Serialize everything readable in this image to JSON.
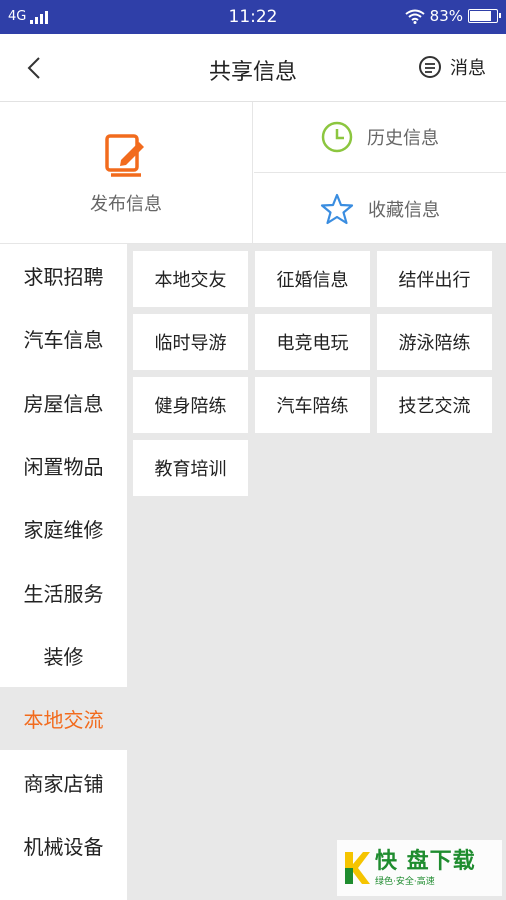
{
  "status_bar": {
    "network": "4G",
    "time": "11:22",
    "battery": "83%",
    "battery_level": 0.83
  },
  "header": {
    "title": "共享信息",
    "message_label": "消息"
  },
  "quick_actions": {
    "publish_label": "发布信息",
    "history_label": "历史信息",
    "favorites_label": "收藏信息"
  },
  "categories": [
    {
      "label": "求职招聘"
    },
    {
      "label": "汽车信息"
    },
    {
      "label": "房屋信息"
    },
    {
      "label": "闲置物品"
    },
    {
      "label": "家庭维修"
    },
    {
      "label": "生活服务"
    },
    {
      "label": "装修"
    },
    {
      "label": "本地交流"
    },
    {
      "label": "商家店铺"
    },
    {
      "label": "机械设备"
    }
  ],
  "active_category": "本地交流",
  "subcategories": [
    {
      "label": "本地交友"
    },
    {
      "label": "征婚信息"
    },
    {
      "label": "结伴出行"
    },
    {
      "label": "临时导游"
    },
    {
      "label": "电竞电玩"
    },
    {
      "label": "游泳陪练"
    },
    {
      "label": "健身陪练"
    },
    {
      "label": "汽车陪练"
    },
    {
      "label": "技艺交流"
    },
    {
      "label": "教育培训"
    }
  ],
  "watermark": {
    "main": "快 盘下载",
    "sub": "绿色·安全·高速"
  },
  "colors": {
    "status_bar": "#2f3fa8",
    "accent": "#f26b1d",
    "history_icon": "#8cc63f",
    "star_icon": "#3a8de0"
  }
}
